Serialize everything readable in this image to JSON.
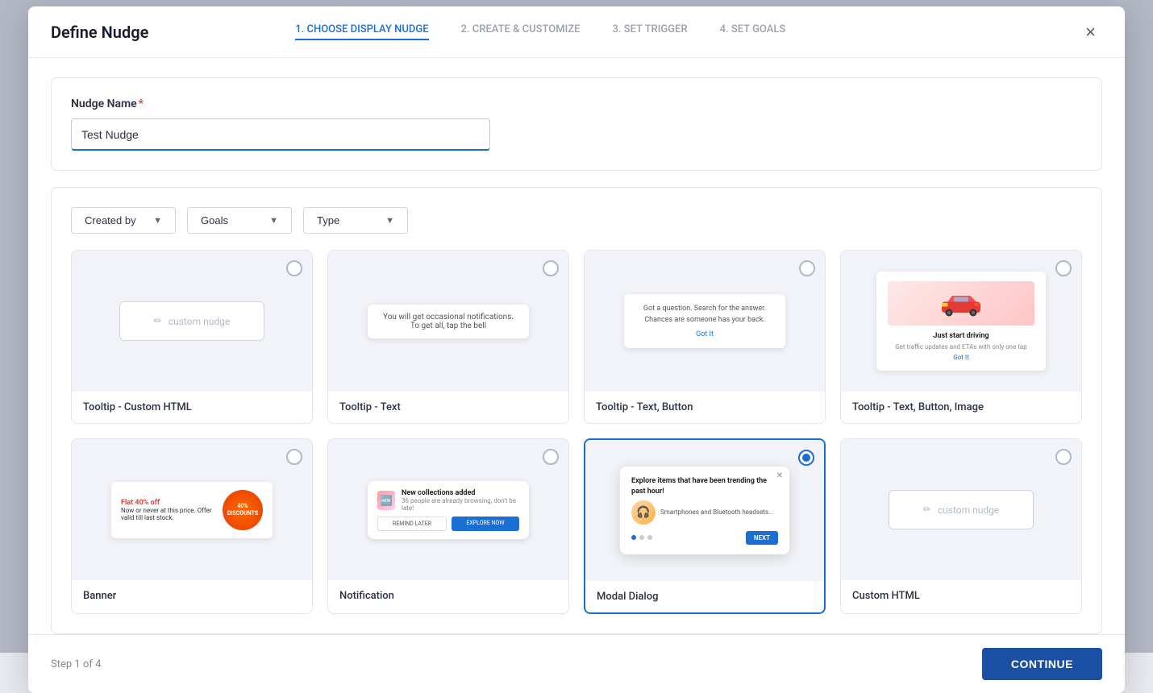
{
  "modal": {
    "title": "Define Nudge",
    "close_label": "×"
  },
  "steps": [
    {
      "id": "step1",
      "label": "1. CHOOSE DISPLAY NUDGE",
      "active": true
    },
    {
      "id": "step2",
      "label": "2. CREATE & CUSTOMIZE",
      "active": false
    },
    {
      "id": "step3",
      "label": "3. SET TRIGGER",
      "active": false
    },
    {
      "id": "step4",
      "label": "4. SET GOALS",
      "active": false
    }
  ],
  "nudge_name": {
    "label": "Nudge Name",
    "required": true,
    "value": "Test Nudge",
    "placeholder": "Test Nudge"
  },
  "filters": [
    {
      "id": "created-by",
      "label": "Created by"
    },
    {
      "id": "goals",
      "label": "Goals"
    },
    {
      "id": "type",
      "label": "Type"
    }
  ],
  "nudge_types": [
    {
      "id": "tooltip-custom-html",
      "label": "Tooltip - Custom HTML",
      "selected": false,
      "preview_type": "custom-html"
    },
    {
      "id": "tooltip-text",
      "label": "Tooltip - Text",
      "selected": false,
      "preview_type": "tooltip-text",
      "preview_text": "You will get occasional notifications. To get all, tap the bell"
    },
    {
      "id": "tooltip-text-button",
      "label": "Tooltip - Text, Button",
      "selected": false,
      "preview_type": "tooltip-text-button",
      "preview_text": "Got a question. Search for the answer. Chances are someone has your back.",
      "button_label": "Got It"
    },
    {
      "id": "tooltip-text-button-image",
      "label": "Tooltip - Text, Button, Image",
      "selected": false,
      "preview_type": "tooltip-text-button-image",
      "title": "Just start driving",
      "desc": "Get traffic updates and ETAs with only one tap",
      "button_label": "Got It"
    },
    {
      "id": "banner",
      "label": "Banner",
      "selected": false,
      "preview_type": "banner",
      "flat_text": "Flat 40% off",
      "desc": "Now or never at this price. Offer valid till last stock.",
      "badge_text": "40% DISCOUNTS"
    },
    {
      "id": "notification",
      "label": "Notification",
      "selected": false,
      "preview_type": "notification",
      "title": "New collections added",
      "subtitle": "36 people are already browsing, don't be late!",
      "btn1": "REMIND LATER",
      "btn2": "EXPLORE NOW"
    },
    {
      "id": "modal-dialog",
      "label": "Modal Dialog",
      "selected": true,
      "preview_type": "modal-dialog",
      "title": "Explore items that have been trending the past hour!",
      "body": "Smartphones and Bluetooth headsets...",
      "next_label": "NEXT"
    },
    {
      "id": "custom-html-2",
      "label": "Custom HTML",
      "selected": false,
      "preview_type": "custom-html-2"
    }
  ],
  "footer": {
    "step_text": "Step 1 of 4",
    "continue_label": "CONTINUE"
  }
}
